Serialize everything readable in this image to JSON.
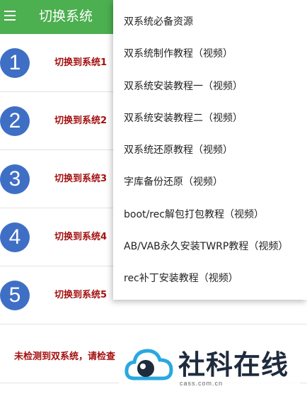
{
  "app": {
    "title": "切换系统",
    "menu_icon": "hamburger-icon"
  },
  "systems": [
    {
      "number": "1",
      "label": "切换到系统1"
    },
    {
      "number": "2",
      "label": "切换到系统2"
    },
    {
      "number": "3",
      "label": "切换到系统3"
    },
    {
      "number": "4",
      "label": "切换到系统4"
    },
    {
      "number": "5",
      "label": "切换到系统5"
    }
  ],
  "status_text": "未检测到双系统，请检查",
  "menu": {
    "items": [
      "双系统必备资源",
      "双系统制作教程（视频）",
      "双系统安装教程一（视频）",
      "双系统安装教程二（视频）",
      "双系统还原教程（视频）",
      "字库备份还原（视频）",
      "boot/rec解包打包教程（视频）",
      "AB/VAB永久安装TWRP教程（视频）",
      "rec补丁安装教程（视频）"
    ]
  },
  "watermark": {
    "text": "社科在线",
    "url": "cass.com.cn"
  },
  "colors": {
    "appbar": "#4CAF50",
    "circle": "#3F6FC5",
    "label": "#a31010"
  }
}
